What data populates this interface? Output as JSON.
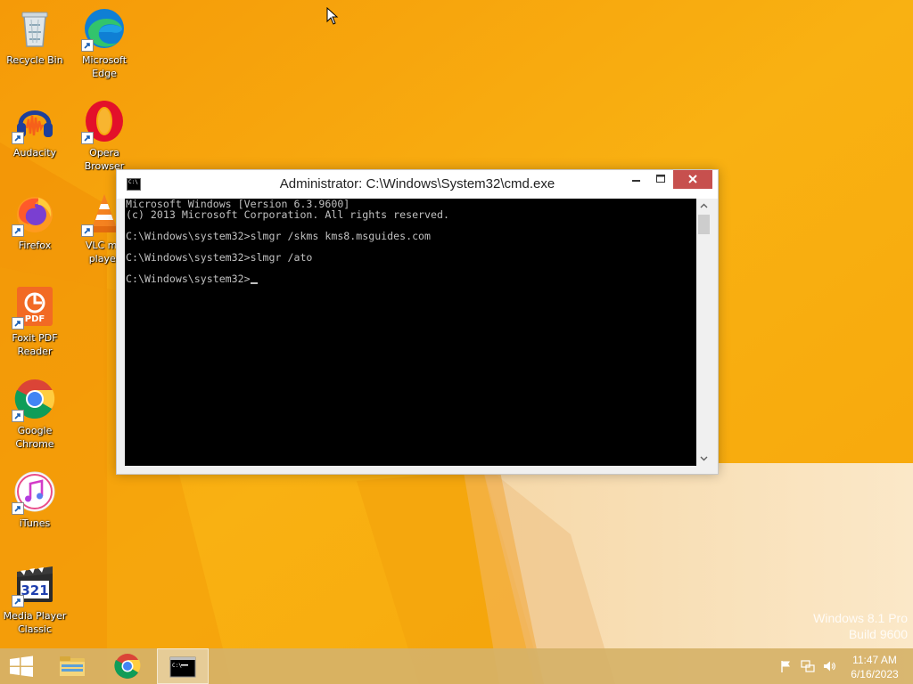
{
  "desktop": {
    "icons": [
      {
        "label_line1": "Recycle Bin",
        "label_line2": "",
        "icon": "recycle-bin-icon"
      },
      {
        "label_line1": "Microsoft",
        "label_line2": "Edge",
        "icon": "edge-icon"
      },
      {
        "label_line1": "Audacity",
        "label_line2": "",
        "icon": "audacity-icon"
      },
      {
        "label_line1": "Opera",
        "label_line2": "Browser",
        "icon": "opera-icon"
      },
      {
        "label_line1": "Firefox",
        "label_line2": "",
        "icon": "firefox-icon"
      },
      {
        "label_line1": "VLC me",
        "label_line2": "player",
        "icon": "vlc-icon"
      },
      {
        "label_line1": "Foxit PDF",
        "label_line2": "Reader",
        "icon": "foxit-pdf-icon"
      },
      {
        "label_line1": "Google",
        "label_line2": "Chrome",
        "icon": "chrome-icon"
      },
      {
        "label_line1": "iTunes",
        "label_line2": "",
        "icon": "itunes-icon"
      },
      {
        "label_line1": "Media Player",
        "label_line2": "Classic",
        "icon": "media-player-classic-icon"
      }
    ]
  },
  "cmd_window": {
    "title": "Administrator: C:\\Windows\\System32\\cmd.exe",
    "sys_icon_text": "C:\\",
    "console": {
      "line1": "Microsoft Windows [Version 6.3.9600]",
      "line2": "(c) 2013 Microsoft Corporation. All rights reserved.",
      "line3": "C:\\Windows\\system32>slmgr /skms kms8.msguides.com",
      "line4": "C:\\Windows\\system32>slmgr /ato",
      "line5": "C:\\Windows\\system32>"
    }
  },
  "watermark": {
    "line1": "Windows 8.1 Pro",
    "line2": "Build 9600"
  },
  "taskbar": {
    "items": [
      "start-button",
      "file-explorer",
      "google-chrome",
      "command-prompt"
    ],
    "tray": {
      "icons": [
        "action-center-flag-icon",
        "network-icon",
        "volume-icon"
      ],
      "time": "11:47 AM",
      "date": "6/16/2023"
    }
  },
  "colors": {
    "wallpaper_orange": "#f7a90c",
    "console_bg": "#000000",
    "console_text": "#c0c0c0",
    "close_button": "#c7504e"
  }
}
